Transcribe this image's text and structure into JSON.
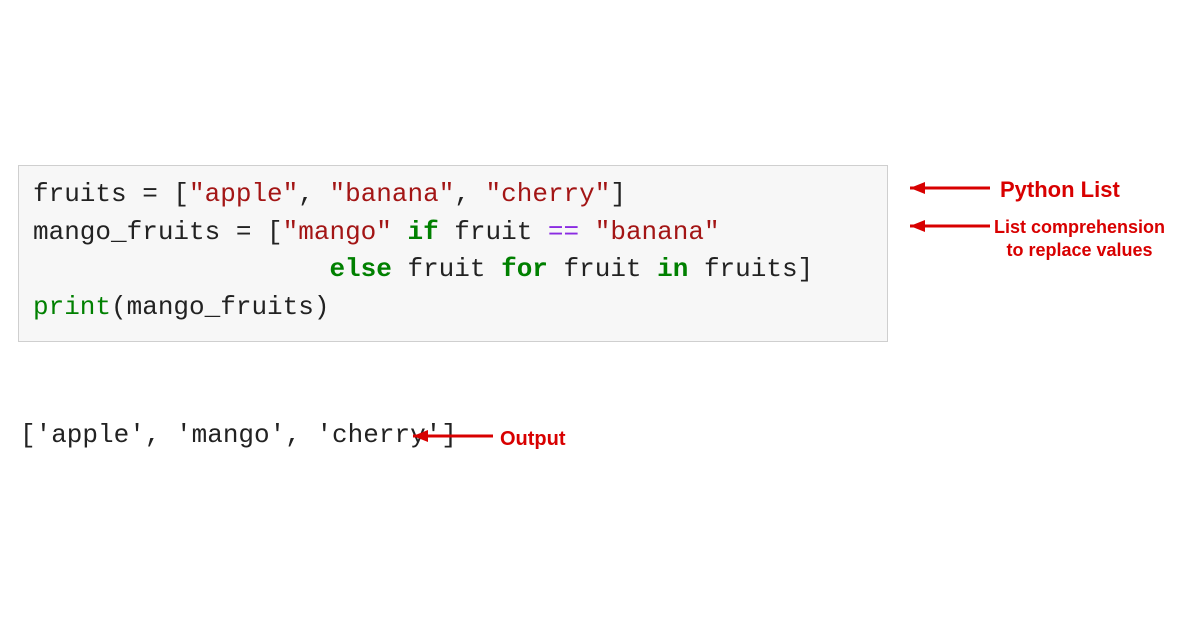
{
  "code": {
    "line1": {
      "var": "fruits",
      "assign": " = [",
      "s1": "\"apple\"",
      "c1": ", ",
      "s2": "\"banana\"",
      "c2": ", ",
      "s3": "\"cherry\"",
      "close": "]"
    },
    "line2": {
      "var": "mango_fruits",
      "assign": " = [",
      "s1": "\"mango\"",
      "sp1": " ",
      "kw1": "if",
      "sp2": " fruit ",
      "op": "==",
      "sp3": " ",
      "s2": "\"banana\""
    },
    "line3": {
      "indent": "                   ",
      "kw1": "else",
      "mid1": " fruit ",
      "kw2": "for",
      "mid2": " fruit ",
      "kw3": "in",
      "mid3": " fruits]"
    },
    "line4": "",
    "line5": {
      "fn": "print",
      "args": "(mango_fruits)"
    }
  },
  "output": "['apple', 'mango', 'cherry']",
  "annotations": {
    "a1": "Python List",
    "a2_l1": "List comprehension",
    "a2_l2": "to replace values",
    "a3": "Output"
  }
}
